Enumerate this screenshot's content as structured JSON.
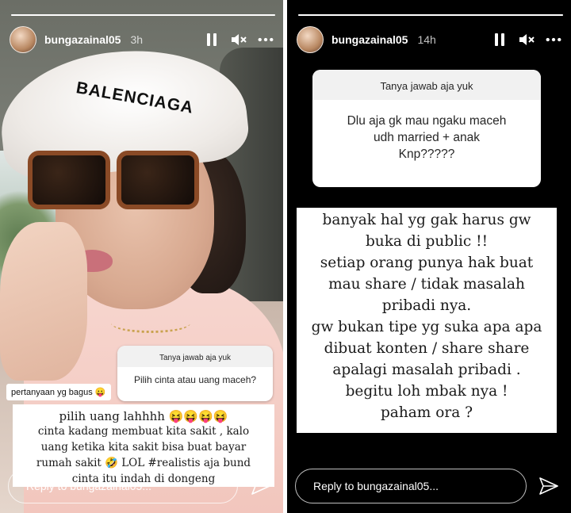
{
  "left_story": {
    "progress": 1.0,
    "username": "bungazainal05",
    "time": "3h",
    "cap_brand": "BALENCIAGA",
    "sticker_comment": "pertanyaan yg bagus 😛",
    "question": {
      "title": "Tanya jawab aja yuk",
      "text": "Pilih cinta atau uang maceh?"
    },
    "answer_lines": [
      "pilih uang lahhhh 😝😝😝😝",
      "cinta kadang membuat kita sakit , kalo",
      "uang ketika kita sakit bisa buat bayar",
      "rumah sakit 🤣 LOL #realistis aja bund",
      "cinta itu indah di dongeng"
    ],
    "reply_placeholder": "Reply to bungazainal05..."
  },
  "right_story": {
    "progress": 1.0,
    "username": "bungazainal05",
    "time": "14h",
    "question": {
      "title": "Tanya jawab aja yuk",
      "text_lines": [
        "Dlu aja gk mau ngaku maceh",
        "udh married + anak",
        "Knp?????"
      ]
    },
    "answer_lines": [
      "banyak hal yg  gak harus gw",
      "buka di public !!",
      "setiap orang punya hak buat",
      "mau share / tidak masalah",
      "pribadi nya.",
      "gw bukan tipe yg suka apa apa",
      "dibuat konten / share share",
      "apalagi masalah pribadi .",
      "begitu loh mbak nya !",
      "paham ora ?"
    ],
    "reply_placeholder": "Reply to bungazainal05..."
  },
  "icons": {
    "pause": "pause-icon",
    "mute": "speaker-muted-icon",
    "more": "more-icon",
    "send": "paper-plane-icon"
  },
  "colors": {
    "story_dark_bg": "#000000",
    "text_white": "#ffffff",
    "sticker_bg": "#ffffff",
    "sticker_header_bg": "#f1f1f1"
  }
}
